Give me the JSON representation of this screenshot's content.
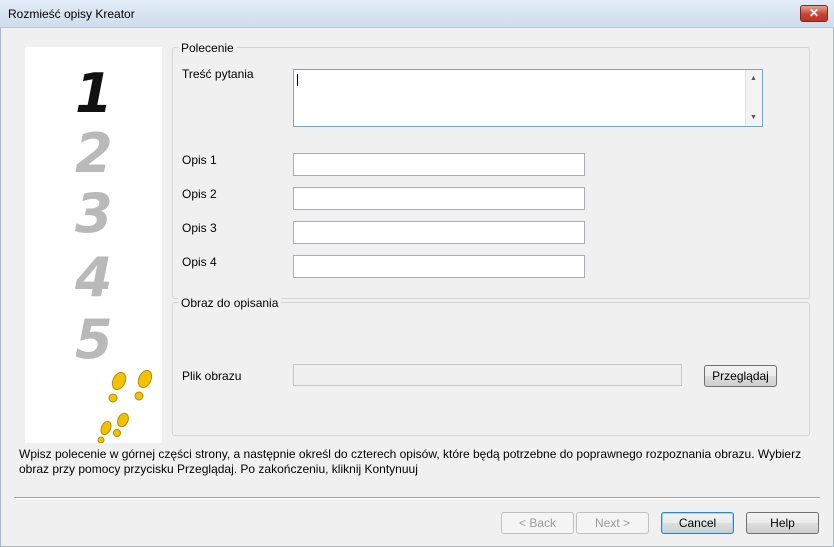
{
  "window": {
    "title": "Rozmieść opisy Kreator",
    "close_label": "✕"
  },
  "steps": [
    "1",
    "2",
    "3",
    "4",
    "5"
  ],
  "polecenie": {
    "group_title": "Polecenie",
    "question_label": "Treść pytania",
    "question_value": "",
    "descriptions": [
      {
        "label": "Opis 1",
        "value": ""
      },
      {
        "label": "Opis 2",
        "value": ""
      },
      {
        "label": "Opis 3",
        "value": ""
      },
      {
        "label": "Opis 4",
        "value": ""
      }
    ]
  },
  "image_group": {
    "group_title": "Obraz do opisania",
    "file_label": "Plik obrazu",
    "file_value": "",
    "browse_label": "Przeglądaj"
  },
  "info_text": "Wpisz polecenie w górnej części strony, a następnie określ do czterech opisów, które będą potrzebne do poprawnego rozpoznania obrazu. Wybierz obraz przy pomocy przycisku Przeglądaj. Po zakończeniu, kliknij Kontynuuj",
  "buttons": {
    "back": "< Back",
    "next": "Next >",
    "cancel": "Cancel",
    "help": "Help"
  },
  "colors": {
    "title_bar": "#cfdcec",
    "close": "#c74632",
    "footprints": "#f2c200"
  }
}
